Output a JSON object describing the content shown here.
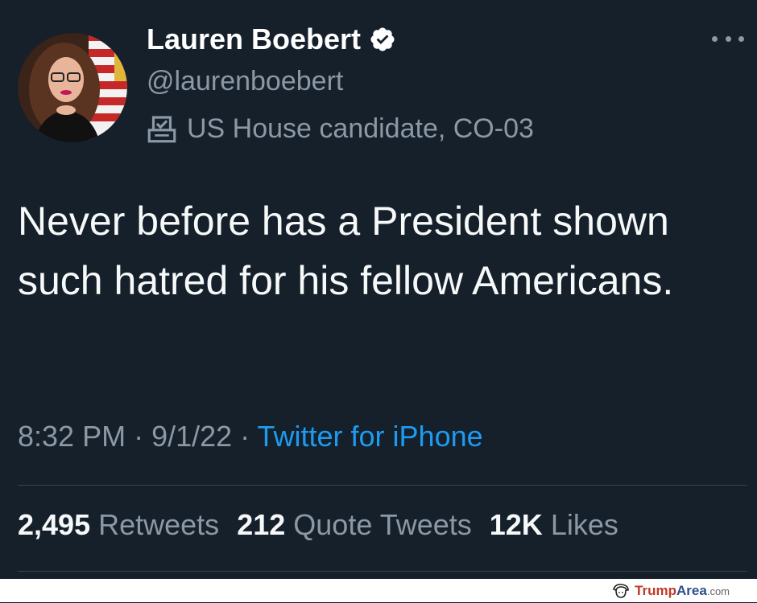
{
  "tweet": {
    "author": {
      "display_name": "Lauren Boebert",
      "handle": "@laurenboebert",
      "label": "US House candidate, CO-03",
      "verified": true
    },
    "text": "Never before has a President shown such hatred for his fellow Americans.",
    "meta": {
      "time": "8:32 PM",
      "separator1": " · ",
      "date": "9/1/22",
      "separator2": " · ",
      "source": "Twitter for iPhone"
    },
    "stats": {
      "retweets_count": "2,495",
      "retweets_label": "Retweets",
      "quotes_count": "212",
      "quotes_label": "Quote Tweets",
      "likes_count": "12K",
      "likes_label": "Likes"
    }
  },
  "watermark": {
    "brand_part1": "Trump",
    "brand_part2": "Area",
    "brand_suffix": ".com"
  },
  "colors": {
    "background": "#15202b",
    "text_primary": "#f7f9f9",
    "text_secondary": "#8b98a5",
    "link": "#1d9bf0",
    "divider": "#38444d"
  },
  "icons": {
    "verified": "verified-badge-icon",
    "label": "ballot-box-icon",
    "more": "more-dots-icon",
    "watermark": "trump-hair-icon"
  }
}
